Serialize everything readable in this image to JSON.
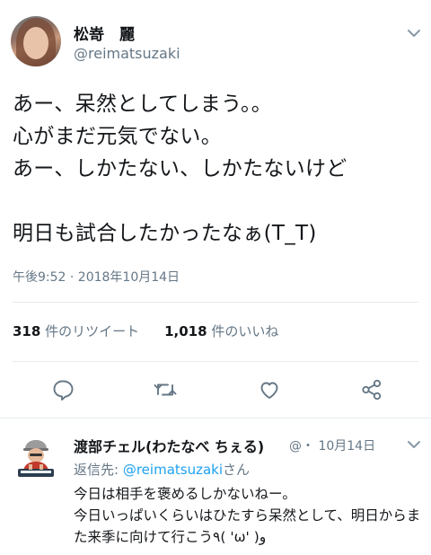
{
  "tweet": {
    "display_name": "松嵜　麗",
    "handle": "@reimatsuzaki",
    "text": "あー、呆然としてしまう。。\n心がまだ元気でない。\nあー、しかたない、しかたないけど\n\n明日も試合したかったなぁ(T_T)",
    "timestamp": "午後9:52 · 2018年10月14日",
    "stats": {
      "retweets_count": "318",
      "retweets_label": "件のリツイート",
      "likes_count": "1,018",
      "likes_label": "件のいいね"
    },
    "icons": {
      "menu": "chevron-down-icon",
      "reply": "reply-bubble-icon",
      "retweet": "retweet-icon",
      "like": "heart-icon",
      "share": "share-icon"
    }
  },
  "reply": {
    "display_name": "渡部チェル(わたなべ ちぇる)",
    "handle_fragment": "@・",
    "date": "10月14日",
    "reply_to_label": "返信先:",
    "reply_to_handle": "@reimatsuzaki",
    "reply_to_suffix": "さん",
    "text": "今日は相手を褒めるしかないねー。\n今日いっぱいくらいはひたすら呆然として、明日からまた来季に向けて行こう٩( 'ω' )و",
    "icons": {
      "menu": "chevron-down-icon"
    }
  },
  "colors": {
    "text_primary": "#14171a",
    "text_secondary": "#657786",
    "link": "#1da1f2",
    "divider": "#e6ecf0"
  }
}
